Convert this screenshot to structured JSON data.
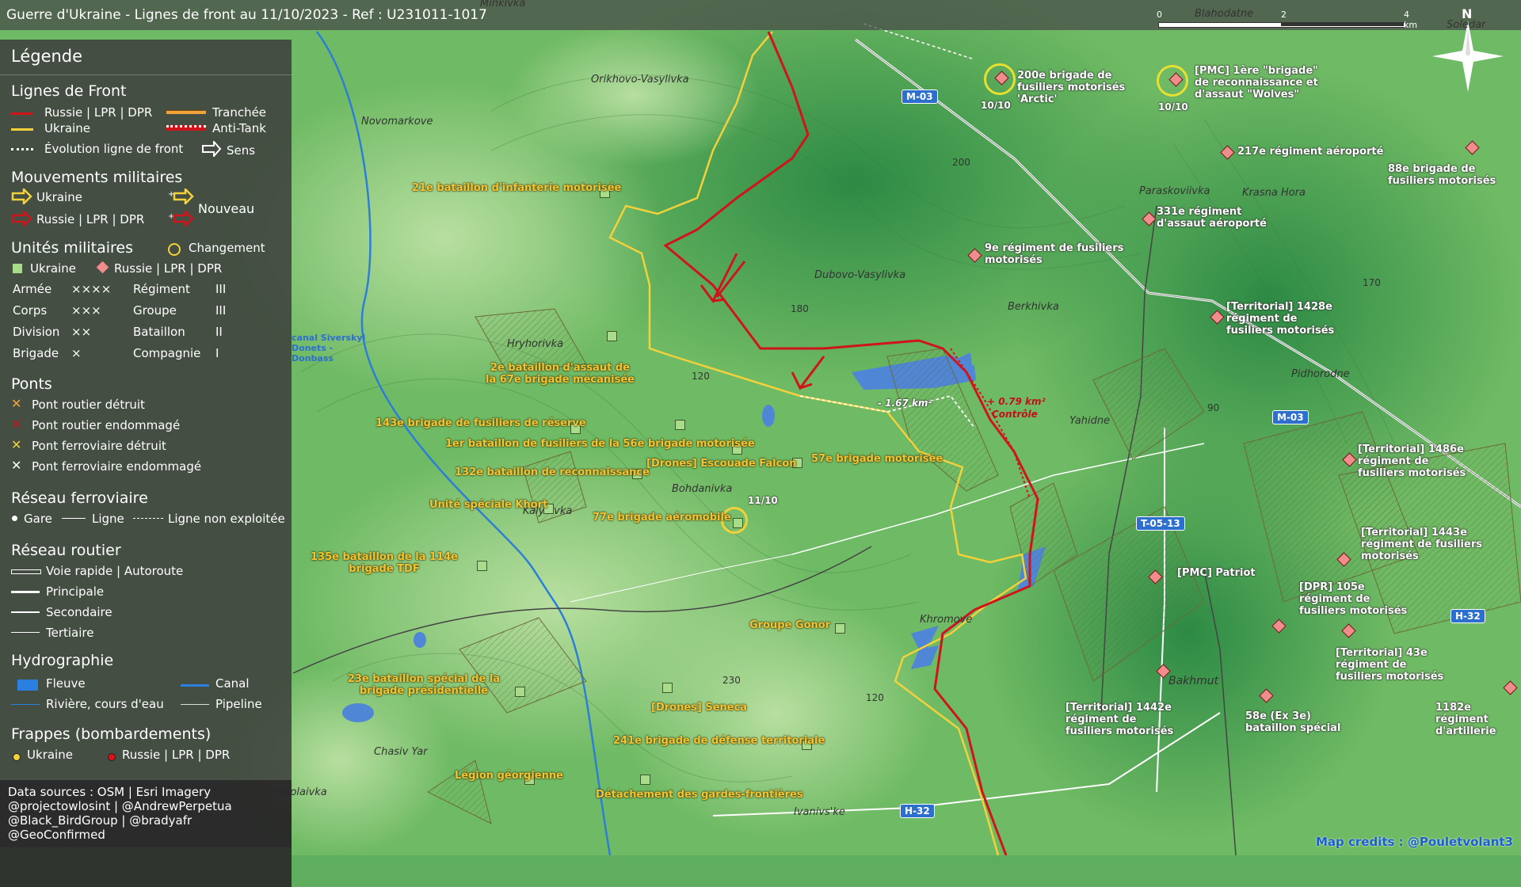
{
  "header": {
    "title": "Guerre d'Ukraine - Lignes de front au 11/10/2023 - Ref : U231011-1017"
  },
  "legend": {
    "title": "Légende",
    "front_lines": {
      "heading": "Lignes de Front",
      "russia": "Russie | LPR | DPR",
      "ukraine": "Ukraine",
      "trench": "Tranchée",
      "anti_tank": "Anti-Tank",
      "evolution": "Évolution ligne de front",
      "direction": "Sens"
    },
    "movements": {
      "heading": "Mouvements militaires",
      "ukraine": "Ukraine",
      "russia": "Russie | LPR | DPR",
      "new": "Nouveau"
    },
    "units": {
      "heading": "Unités militaires",
      "change": "Changement",
      "ukraine": "Ukraine",
      "russia": "Russie | LPR | DPR",
      "rows": [
        {
          "a": "Armée",
          "as": "××××",
          "b": "Régiment",
          "bs": "III"
        },
        {
          "a": "Corps",
          "as": "×××",
          "b": "Groupe",
          "bs": "III"
        },
        {
          "a": "Division",
          "as": "××",
          "b": "Bataillon",
          "bs": "II"
        },
        {
          "a": "Brigade",
          "as": "×",
          "b": "Compagnie",
          "bs": "I"
        }
      ]
    },
    "bridges": {
      "heading": "Ponts",
      "items": [
        "Pont routier détruit",
        "Pont routier endommagé",
        "Pont ferroviaire détruit",
        "Pont ferroviaire endommagé"
      ]
    },
    "rail": {
      "heading": "Réseau ferroviaire",
      "station": "Gare",
      "line": "Ligne",
      "unused": "Ligne non exploitée"
    },
    "roads": {
      "heading": "Réseau routier",
      "items": [
        "Voie rapide | Autoroute",
        "Principale",
        "Secondaire",
        "Tertiaire"
      ]
    },
    "hydro": {
      "heading": "Hydrographie",
      "river": "Fleuve",
      "canal": "Canal",
      "stream": "Rivière, cours d'eau",
      "pipeline": "Pipeline"
    },
    "strikes": {
      "heading": "Frappes (bombardements)",
      "ukraine": "Ukraine",
      "russia": "Russie | LPR | DPR"
    },
    "sources": [
      "Data sources : OSM | Esri Imagery",
      "@projectowlosint | @AndrewPerpetua",
      "@Black_BirdGroup | @bradyafr",
      "@GeoConfirmed"
    ]
  },
  "colors": {
    "russia": "#d0141c",
    "ukraine": "#f2d13a",
    "water": "#4f86d6",
    "legend_bg": "#3c3c3c"
  },
  "scale": {
    "labels": [
      "0",
      "2",
      "4 km"
    ]
  },
  "north": "N",
  "credits": "Map credits : @Pouletvolant3",
  "roads": {
    "m03_a": "M-03",
    "m03_b": "M-03",
    "t0513": "T-05-13",
    "h32_a": "H-32",
    "h32_b": "H-32"
  },
  "places": [
    "Minkivka",
    "Blahodatne",
    "Soledar",
    "Orikhovo-Vasylivka",
    "Novomarkove",
    "Paraskoviivka",
    "Krasna Hora",
    "Dubovo-Vasylivka",
    "Berkhivka",
    "Hryhorivka",
    "Yahidne",
    "Pidhorodne",
    "Bohdanivka",
    "Kalynivka",
    "Khromove",
    "Bakhmut",
    "Chasiv Yar",
    "Ivanivs'ke",
    "Mykolaivka"
  ],
  "terrain": [
    "200",
    "180",
    "120",
    "170",
    "90",
    "230",
    "120"
  ],
  "canal_label": "canal Siverskyi Donets - Donbass",
  "ua_units": [
    "21e bataillon d'infanterie motorisée",
    "2e bataillon d'assaut de la 67e brigade mécanisée",
    "143e brigade de fusiliers de réserve",
    "1er bataillon de fusiliers de la 56e brigade motorisée",
    "132e bataillon de reconnaissance",
    "[Drones] Escouade Falcon",
    "57e brigade motorisée",
    "Unité spéciale Khort",
    "77e brigade aéromobile",
    "135e bataillon de la 114e brigade TDF",
    "Groupe Gonor",
    "23e bataillon spécial de la brigade présidentielle",
    "[Drones] Seneca",
    "241e brigade de défense territoriale",
    "Légion géorgienne",
    "Détachement des gardes-frontières"
  ],
  "ru_units": [
    "200e brigade de fusiliers motorisés 'Arctic'",
    "[PMC] 1ère \"brigade\" de reconnaissance et d'assaut \"Wolves\"",
    "217e régiment aéroporté",
    "88e brigade de fusiliers motorisés",
    "331e régiment d'assaut aéroporté",
    "9e régiment de fusiliers motorisés",
    "[Territorial] 1428e régiment de fusiliers motorisés",
    "[Territorial] 1486e régiment de fusiliers motorisés",
    "[Territorial] 1443e régiment de fusiliers motorisés",
    "[PMC] Patriot",
    "[DPR] 105e régiment de fusiliers motorisés",
    "[Territorial] 43e régiment de fusiliers motorisés",
    "[Territorial] 1442e régiment de fusiliers motorisés",
    "58e (Ex 3e) bataillon spécial",
    "1182e régiment d'artillerie"
  ],
  "dates": [
    "10/10",
    "10/10",
    "11/10"
  ],
  "areas": {
    "loss": "- 1.67 km²",
    "gain": "+ 0.79 km²",
    "gain_note": "Contrôle"
  }
}
